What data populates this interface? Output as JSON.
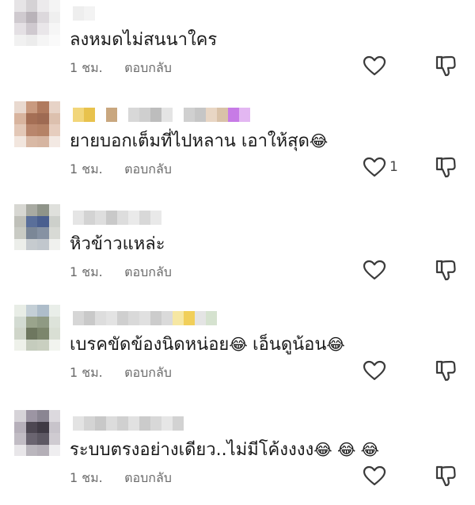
{
  "comments": [
    {
      "avatar_colors": [
        "#e6e4e6",
        "#d5d2d5",
        "#eceaec",
        "#f4f4f4",
        "#cfcacf",
        "#b9b3b9",
        "#dcd8dc",
        "#efefef",
        "#e4e0e4",
        "#cfc9cf",
        "#e9e6e9",
        "#f6f6f6",
        "#f1f1f1",
        "#ececec",
        "#f5f5f5",
        "#fafafa"
      ],
      "name_colors": [
        "#eeeeee",
        "#f3f3f3"
      ],
      "text": "ลงหมดไม่สนนาใคร",
      "emoji": "",
      "time": "1 ชม.",
      "reply": "ตอบกลับ",
      "likes": ""
    },
    {
      "avatar_colors": [
        "#e9d9cf",
        "#c99a7f",
        "#b07a5e",
        "#e7d3c7",
        "#d8b49e",
        "#a56f55",
        "#9e6a52",
        "#dcc0ae",
        "#e3c8b7",
        "#b9866c",
        "#b58266",
        "#e6cdbe",
        "#f2e6de",
        "#d9b9a5",
        "#d6b5a1",
        "#f3e9e3"
      ],
      "name_colors": [
        "#f2d67a",
        "#e8c24d",
        "#ffffff",
        "#c9a77f",
        "#ffffff",
        "#d8d8d8",
        "#cfcfcf",
        "#bdbdbd",
        "#e4e4e4",
        "#ffffff",
        "#d0d0d0",
        "#c6c6c6",
        "#e8d6c4",
        "#d9c2a8",
        "#c77be6",
        "#e3b7f2"
      ],
      "text": "ยายบอกเต็มที่ไปหลาน เอาให้สุด",
      "emoji": "😂",
      "time": "1 ชม.",
      "reply": "ตอบกลับ",
      "likes": "1"
    },
    {
      "avatar_colors": [
        "#d7d7d2",
        "#a8aaa2",
        "#8f9489",
        "#dfe0dc",
        "#bfc0b9",
        "#5a6f9a",
        "#4a5f8f",
        "#cdd0cb",
        "#c9cbc4",
        "#7b8797",
        "#8692a3",
        "#d8dad5",
        "#eceeea",
        "#c6cbcf",
        "#c1c7cd",
        "#f0f1ee"
      ],
      "name_colors": [
        "#e5e5e5",
        "#d3d3d3",
        "#dedede",
        "#c9c9c9",
        "#dddddd",
        "#eaeaea",
        "#d8d8d8",
        "#e9e9e9"
      ],
      "text": "หิวข้าวแหล่ะ",
      "emoji": "",
      "time": "1 ชม.",
      "reply": "ตอบกลับ",
      "likes": ""
    },
    {
      "avatar_colors": [
        "#e8ede6",
        "#c4cfd6",
        "#aebdca",
        "#e9eee9",
        "#d3dbd2",
        "#9aa48c",
        "#8f9a83",
        "#dde3da",
        "#cfd5c9",
        "#6e775f",
        "#7c866c",
        "#d9dfd4",
        "#eef1ea",
        "#c5ccbd",
        "#c9cfc0",
        "#f2f4ef"
      ],
      "name_colors": [
        "#d6d6d6",
        "#c9c9c9",
        "#dddddd",
        "#e3e3e3",
        "#cfcfcf",
        "#d9d9d9",
        "#e0e0e0",
        "#cccccc",
        "#dadada",
        "#f6e7a3",
        "#f1cf5a",
        "#e4e4e4",
        "#d5e2cf"
      ],
      "text": "เบรคขัดข้องนิดหน่อย",
      "emoji": "😂",
      "text2": "เอ็นดูน้อน",
      "emoji2": "😂",
      "time": "1 ชม.",
      "reply": "ตอบกลับ",
      "likes": ""
    },
    {
      "avatar_colors": [
        "#d6d3d8",
        "#9c95a3",
        "#8a8592",
        "#dcd9de",
        "#b6b0ba",
        "#4d4752",
        "#3f3a44",
        "#c8c4cb",
        "#c1bcc4",
        "#6a6470",
        "#5d5863",
        "#cfcbd1",
        "#e8e6e9",
        "#bab6bd",
        "#b4afb7",
        "#efeef0"
      ],
      "name_colors": [
        "#e3e3e3",
        "#d4d4d4",
        "#c8c8c8",
        "#dcdcdc",
        "#d0d0d0",
        "#e1e1e1",
        "#cbcbcb",
        "#d8d8d8",
        "#e6e6e6",
        "#d2d2d2"
      ],
      "text": "ระบบตรงอย่างเดียว..ไม่มีโค้งงงง",
      "emoji": "😂 😂 😂",
      "time": "1 ชม.",
      "reply": "ตอบกลับ",
      "likes": ""
    }
  ],
  "icons": {
    "like": "heart-outline-icon",
    "dislike": "thumbs-down-outline-icon",
    "icon_color": "#3a3a3a"
  }
}
